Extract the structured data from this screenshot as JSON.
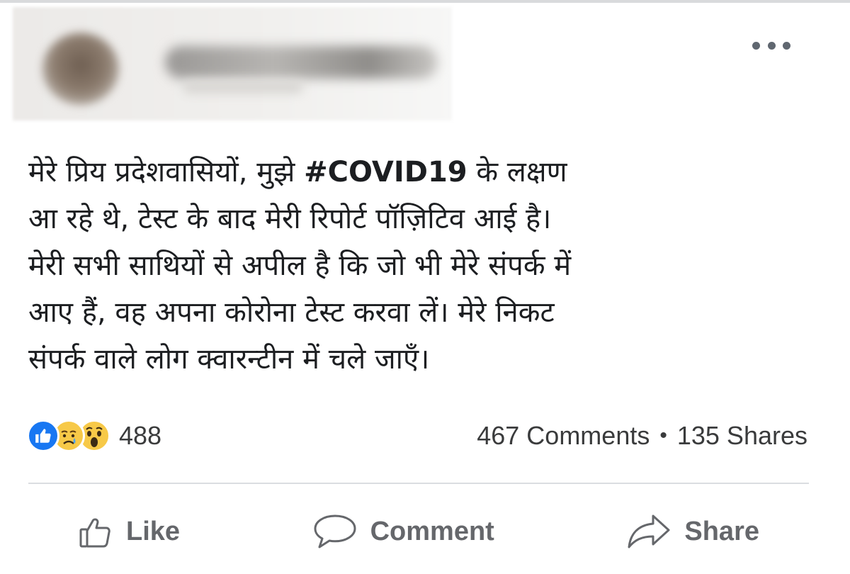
{
  "post": {
    "text_lines": [
      {
        "before": "मेरे प्रिय प्रदेशवासियों, मुझे ",
        "hashtag": "#COVID19",
        "after": " के लक्षण"
      },
      {
        "text": "आ रहे थे, टेस्ट के बाद मेरी रिपोर्ट पॉज़िटिव आई है।"
      },
      {
        "text": "मेरी सभी साथियों से अपील है कि जो भी मेरे संपर्क में"
      },
      {
        "text": "आए हैं, वह अपना कोरोना टेस्ट करवा लें। मेरे निकट"
      },
      {
        "text": "संपर्क वाले लोग क्वारन्टीन में चले जाएँ।"
      }
    ]
  },
  "reactions": {
    "icons": [
      "like-icon",
      "sad-icon",
      "wow-icon"
    ],
    "count": "488"
  },
  "stats": {
    "comments": "467 Comments",
    "separator": "•",
    "shares": "135 Shares"
  },
  "actions": {
    "like": "Like",
    "comment": "Comment",
    "share": "Share"
  },
  "colors": {
    "like_blue": "#1877f2",
    "emoji_yellow": "#f7c948",
    "action_gray": "#65676b"
  }
}
